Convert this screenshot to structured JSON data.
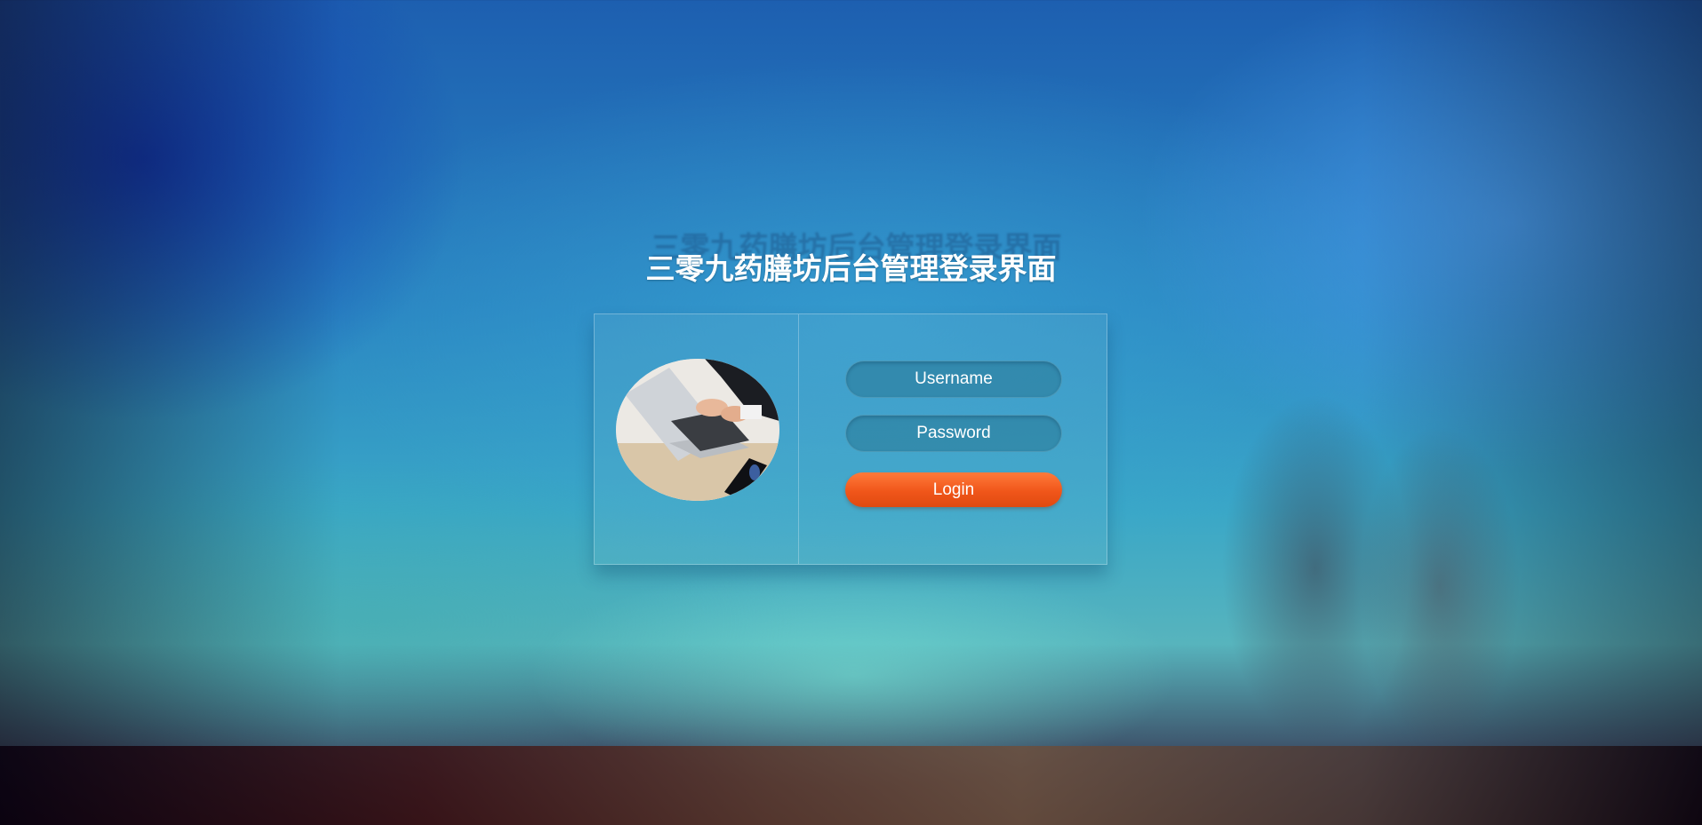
{
  "page": {
    "title": "三零九药膳坊后台管理登录界面"
  },
  "login_form": {
    "username_placeholder": "Username",
    "password_placeholder": "Password",
    "login_label": "Login"
  },
  "colors": {
    "login_button": "#f0561a",
    "input_background": "#2c7d98",
    "title_text": "#ffffff"
  }
}
